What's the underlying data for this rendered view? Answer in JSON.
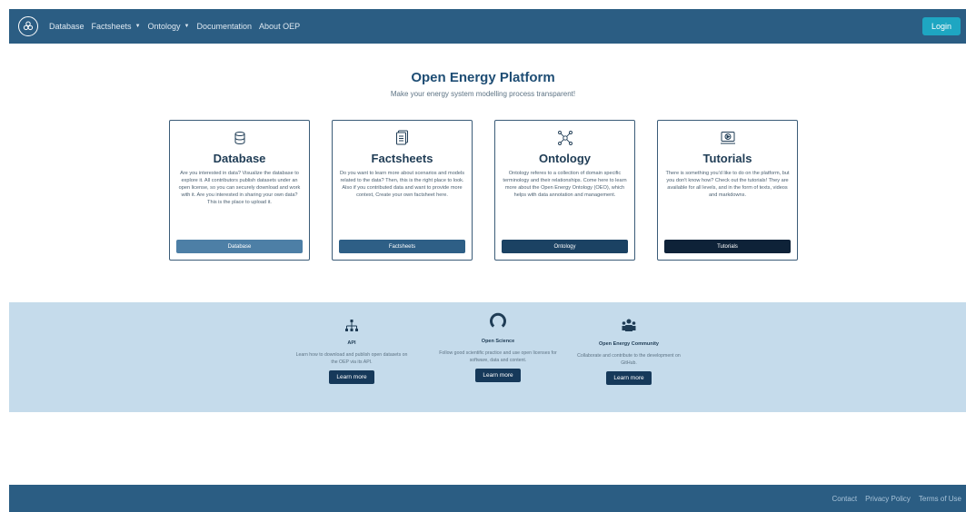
{
  "nav": {
    "items": [
      {
        "label": "Database",
        "dropdown": false
      },
      {
        "label": "Factsheets",
        "dropdown": true
      },
      {
        "label": "Ontology",
        "dropdown": true
      },
      {
        "label": "Documentation",
        "dropdown": false
      },
      {
        "label": "About OEP",
        "dropdown": false
      }
    ],
    "login_label": "Login"
  },
  "hero": {
    "title": "Open Energy Platform",
    "subtitle": "Make your energy system modelling process transparent!"
  },
  "cards": [
    {
      "icon": "database-icon",
      "title": "Database",
      "text": "Are you interested in data? Visualize the database to explore it. All contributors publish datasets under an open license, so you can securely download and work with it. Are you interested in sharing your own data? This is the place to upload it.",
      "button": "Database",
      "button_color": "#4d7fa6"
    },
    {
      "icon": "factsheet-icon",
      "title": "Factsheets",
      "text": "Do you want to learn more about scenarios and models related to the data? Then, this is the right place to look. Also if you contributed data and want to provide more context, Create your own factsheet here.",
      "button": "Factsheets",
      "button_color": "#2e5f86"
    },
    {
      "icon": "ontology-icon",
      "title": "Ontology",
      "text": "Ontology referes to a collection of domain specific terminology and their relationships. Come here to learn more about the Open Energy Ontology (OEO), which helps with data annotation and management.",
      "button": "Ontology",
      "button_color": "#1b4263"
    },
    {
      "icon": "tutorial-icon",
      "title": "Tutorials",
      "text": "There is something you'd like to do on the platform, but you don't know how? Check out the tutorials! They are available for all levels, and in the form of texts, videos and markdowns.",
      "button": "Tutorials",
      "button_color": "#0e2238"
    }
  ],
  "features": [
    {
      "icon": "api-hierarchy-icon",
      "title": "API",
      "text": "Learn how to download and publish open datasets on the OEP via its API.",
      "button": "Learn more"
    },
    {
      "icon": "open-science-icon",
      "title": "Open Science",
      "text": "Follow good scientific practice and use open licenses for software, data and content.",
      "button": "Learn more"
    },
    {
      "icon": "community-icon",
      "title": "Open Energy Community",
      "text": "Collaborate and contribute to the development on GitHub.",
      "button": "Learn more"
    }
  ],
  "footer": {
    "links": [
      "Contact",
      "Privacy Policy",
      "Terms of Use"
    ]
  },
  "colors": {
    "navbar": "#2b5d83",
    "login": "#1ea6c2",
    "band": "#c5dbeb",
    "feature_button": "#16395a"
  }
}
